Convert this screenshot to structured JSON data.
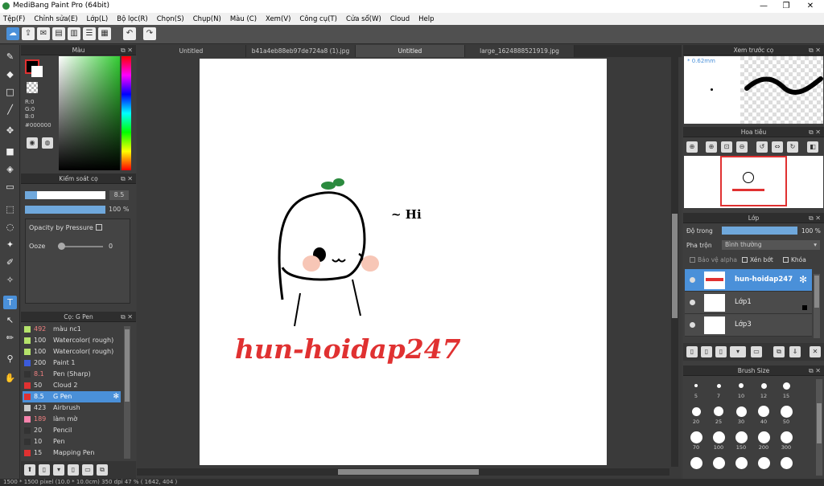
{
  "title": "MediBang Paint Pro (64bit)",
  "window": {
    "minimize": "—",
    "maximize": "❐",
    "close": "✕"
  },
  "menu": [
    "Tệp(F)",
    "Chỉnh sửa(E)",
    "Lớp(L)",
    "Bộ lọc(R)",
    "Chọn(S)",
    "Chụp(N)",
    "Màu (C)",
    "Xem(V)",
    "Công cụ(T)",
    "Cửa sổ(W)",
    "Cloud",
    "Help"
  ],
  "tabs": [
    "Untitled",
    "b41a4eb88eb97de724a8 (1).jpg",
    "Untitled",
    "large_1624888521919.jpg"
  ],
  "color_panel": {
    "title": "Màu",
    "r": "R:0",
    "g": "G:0",
    "b": "B:0",
    "hex": "#000000"
  },
  "brush_control": {
    "title": "Kiểm soát cọ",
    "size": "8.5",
    "opacity": "100 %",
    "opacity_pressure": "Opacity by Pressure",
    "ooze_label": "Ooze",
    "ooze_value": "0",
    "size_fraction": 0.15,
    "opacity_fraction": 1.0
  },
  "brush_list": {
    "title": "Cọ: G Pen",
    "items": [
      {
        "size": "492",
        "name": "màu nc1",
        "color": "#b5e36b"
      },
      {
        "size": "100",
        "name": "Watercolor( rough)",
        "color": "#b5e36b"
      },
      {
        "size": "100",
        "name": "Watercolor( rough)",
        "color": "#b5e36b"
      },
      {
        "size": "200",
        "name": "Paint 1",
        "color": "#3b5bdb"
      },
      {
        "size": "8.1",
        "name": "Pen (Sharp)",
        "color": "#333333"
      },
      {
        "size": "50",
        "name": "Cloud 2",
        "color": "#e03131"
      },
      {
        "size": "8.5",
        "name": "G Pen",
        "color": "#e03131"
      },
      {
        "size": "423",
        "name": "Airbrush",
        "color": "#cccccc"
      },
      {
        "size": "189",
        "name": "làm mờ",
        "color": "#f783ac"
      },
      {
        "size": "20",
        "name": "Pencil",
        "color": "#333333"
      },
      {
        "size": "10",
        "name": "Pen",
        "color": "#333333"
      },
      {
        "size": "15",
        "name": "Mapping Pen",
        "color": "#e03131"
      }
    ],
    "selected_index": 6
  },
  "canvas": {
    "greeting": "~ Hi",
    "watermark": "hun-hoidap247"
  },
  "preview": {
    "title": "Xem trước cọ",
    "size": "* 0.62mm"
  },
  "navigator": {
    "title": "Hoa tiêu"
  },
  "layers": {
    "title": "Lớp",
    "opacity_label": "Độ trong",
    "opacity_value": "100 %",
    "opacity_fraction": 1.0,
    "blend_label": "Pha trộn",
    "blend_value": "Bình thường",
    "protect_alpha": "Bảo vệ alpha",
    "clipping": "Xén bớt",
    "lock": "Khóa",
    "items": [
      {
        "name": "hun-hoidap247"
      },
      {
        "name": "Lớp1"
      },
      {
        "name": "Lớp3"
      }
    ]
  },
  "brush_size": {
    "title": "Brush Size",
    "sizes": [
      "5",
      "7",
      "10",
      "12",
      "15",
      "20",
      "25",
      "30",
      "40",
      "50",
      "70",
      "100",
      "150",
      "200",
      "300",
      "",
      "",
      "",
      "",
      ""
    ]
  },
  "status": "1500 * 1500 pixel  (10.0 * 10.0cm)  350 dpi  47 %  ( 1642, 404 )",
  "colors": {
    "accent": "#4a90d9",
    "watermark": "#e03131",
    "primary": "#000000"
  }
}
